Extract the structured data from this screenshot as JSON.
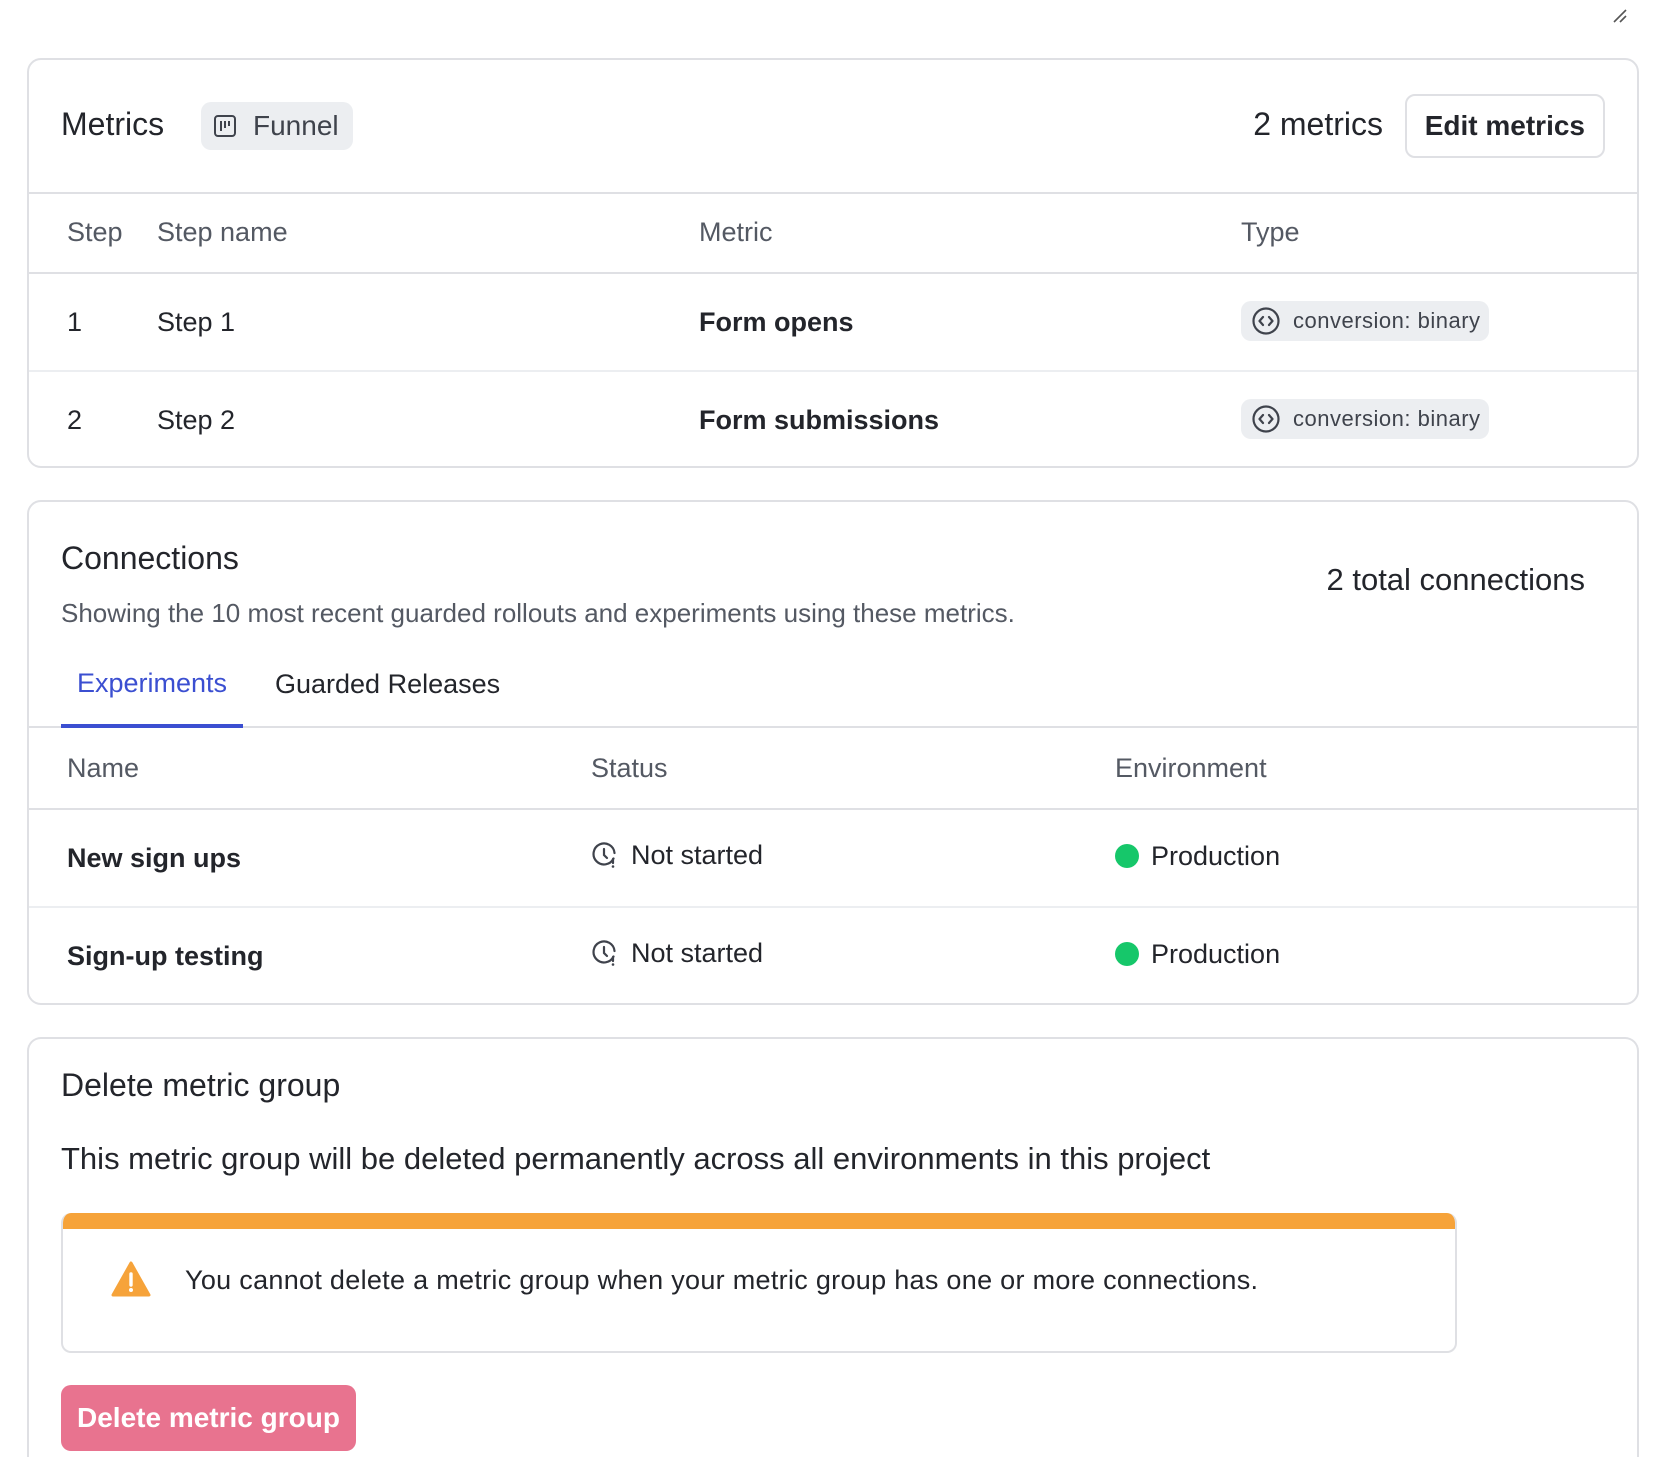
{
  "metrics": {
    "title": "Metrics",
    "kind_badge": "Funnel",
    "count_label": "2 metrics",
    "edit_label": "Edit metrics",
    "columns": [
      "Step",
      "Step name",
      "Metric",
      "Type"
    ],
    "rows": [
      {
        "step": "1",
        "step_name": "Step 1",
        "metric": "Form opens",
        "type": "conversion: binary"
      },
      {
        "step": "2",
        "step_name": "Step 2",
        "metric": "Form submissions",
        "type": "conversion: binary"
      }
    ]
  },
  "connections": {
    "title": "Connections",
    "description": "Showing the 10 most recent guarded rollouts and experiments using these metrics.",
    "total_label": "2 total connections",
    "tabs": [
      "Experiments",
      "Guarded Releases"
    ],
    "active_tab": "Experiments",
    "columns": [
      "Name",
      "Status",
      "Environment"
    ],
    "rows": [
      {
        "name": "New sign ups",
        "status": "Not started",
        "environment": "Production"
      },
      {
        "name": "Sign-up testing",
        "status": "Not started",
        "environment": "Production"
      }
    ],
    "environment_color": "#16c76a"
  },
  "delete": {
    "title": "Delete metric group",
    "description": "This metric group will be deleted permanently across all environments in this project",
    "warning": "You cannot delete a metric group when your metric group has one or more connections.",
    "button_label": "Delete metric group",
    "warning_color": "#f6a33a",
    "button_color": "#e8738f"
  },
  "colors": {
    "accent": "#3b4fd1",
    "border": "#dfe0e4"
  }
}
